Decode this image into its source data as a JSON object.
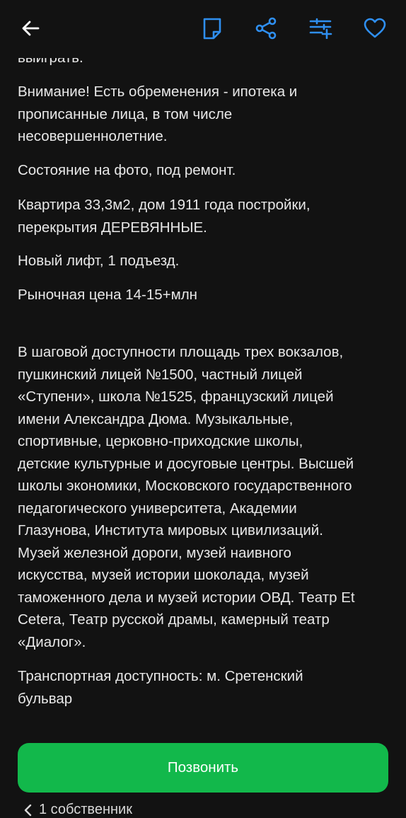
{
  "colors": {
    "background": "#121212",
    "accent": "#2f8ff0",
    "call_button": "#12b84b",
    "text": "#e8e8e8"
  },
  "toolbar": {
    "back_icon": "arrow-left-icon",
    "note_icon": "note-icon",
    "share_icon": "share-icon",
    "compare_icon": "compare-list-icon",
    "favorite_icon": "heart-icon"
  },
  "description": {
    "clipped_line": "выиграть.",
    "paragraphs": [
      "Внимание! Есть обременения - ипотека и\nпрописанные лица, в том числе\nнесовершеннолетние.",
      "Состояние на фото, под ремонт.",
      "Квартира 33,3м2, дом 1911 года постройки,\nперекрытия ДЕРЕВЯННЫЕ.",
      "Новый лифт, 1 подъезд.",
      "Рыночная цена 14-15+млн",
      "В шаговой доступности площадь трех вокзалов,\nпушкинский лицей №1500, частный лицей\n«Ступени», школа №1525, французский лицей\nимени Александра Дюма. Музыкальные,\nспортивные, церковно-приходские школы,\nдетские культурные и досуговые центры. Высшей\nшколы экономики, Московского государственного\nпедагогического университета, Академии\nГлазунова, Института мировых цивилизаций.\nМузей железной дороги, музей наивного\nискусства, музей истории шоколада, музей\nтаможенного дела и музей истории ОВД. Театр Et\nCetera, Театр русской драмы, камерный театр\n«Диалог».",
      "Транспортная доступность: м. Сретенский\nбульвар"
    ]
  },
  "actions": {
    "call_label": "Позвонить"
  },
  "owner": {
    "label": "1 собственник"
  }
}
